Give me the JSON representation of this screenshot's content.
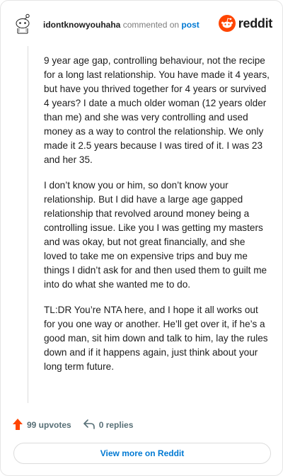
{
  "comment": {
    "username": "idontknowyouhaha",
    "commented_on": "commented on",
    "post_link": "post",
    "brand": "reddit",
    "paragraphs": [
      "9 year age gap, controlling behaviour, not the recipe for a long last relationship. You have made it 4 years, but have you thrived together for 4 years or survived 4 years? I date a much older woman (12 years older than me) and she was very controlling and used money as a way to control the relationship. We only made it 2.5 years because I was tired of it. I was 23 and her 35.",
      "I don’t know you or him, so don’t know your relationship. But I did have a large age gapped relationship that revolved around money being a controlling issue. Like you I was getting my masters and was okay, but not great financially, and she loved to take me on expensive trips and buy me things I didn’t ask for and then used them to guilt me into do what she wanted me to do.",
      "TL:DR You’re NTA here, and I hope it all works out for you one way or another. He’ll get over it, if he’s a good man, sit him down and talk to him, lay the rules down and if it happens again, just think about your long term future."
    ],
    "upvotes": "99 upvotes",
    "replies": "0 replies",
    "view_more": "View more on Reddit"
  },
  "colors": {
    "upvote": "#ff4500",
    "link": "#0079d3",
    "brand": "#ff4500"
  },
  "icons": {
    "avatar": "snoo-avatar-icon",
    "brand": "reddit-logo-icon",
    "upvote": "upvote-arrow-icon",
    "reply": "reply-arrow-icon"
  }
}
